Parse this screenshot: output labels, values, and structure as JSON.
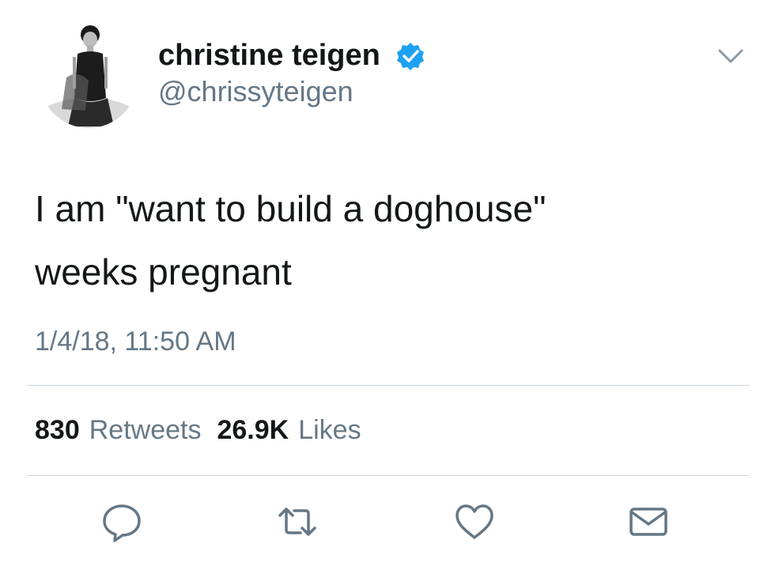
{
  "user": {
    "display_name": "christine teigen",
    "handle": "@chrissyteigen",
    "verified": true,
    "avatar": "profile-photo"
  },
  "tweet": {
    "text_line1": "I am \"want to build a doghouse\"",
    "text_line2": "weeks pregnant",
    "timestamp": "1/4/18, 11:50 AM"
  },
  "stats": {
    "retweets_count": "830",
    "retweets_label": "Retweets",
    "likes_count": "26.9K",
    "likes_label": "Likes"
  },
  "actions": [
    {
      "name": "reply",
      "icon": "reply-icon"
    },
    {
      "name": "retweet",
      "icon": "retweet-icon"
    },
    {
      "name": "like",
      "icon": "heart-icon"
    },
    {
      "name": "direct-message",
      "icon": "envelope-icon"
    }
  ],
  "colors": {
    "text_primary": "#14171a",
    "text_secondary": "#657786",
    "divider": "#ccd6dd",
    "verified": "#1da1f2"
  }
}
